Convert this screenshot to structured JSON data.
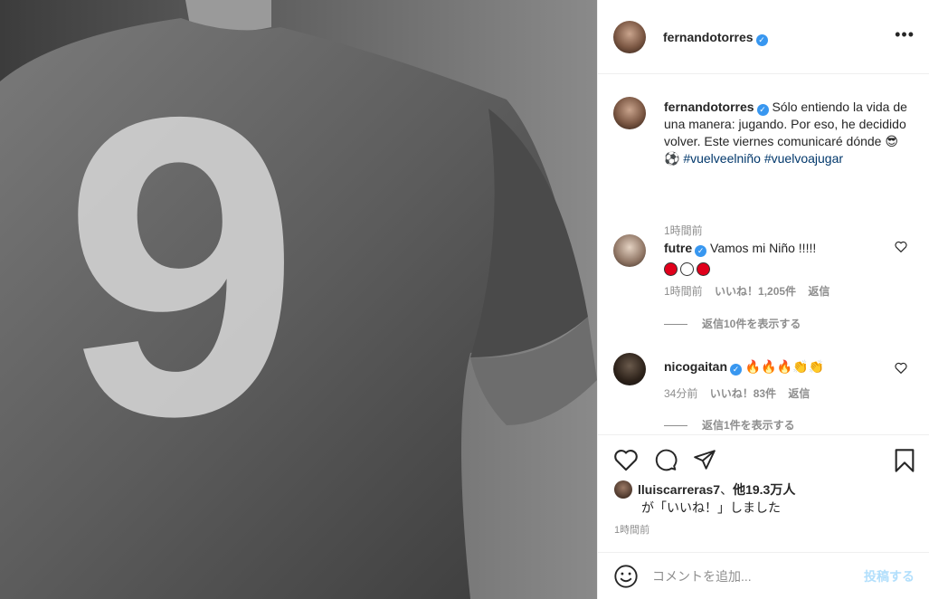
{
  "header": {
    "username": "fernandotorres",
    "verified_glyph": "✓",
    "more_label": "•••"
  },
  "media": {
    "jersey_number": "9"
  },
  "caption": {
    "username": "fernandotorres",
    "text": "Sólo entiendo la vida de una manera: jugando. Por eso, he decidido volver. Este viernes comunicaré dónde 😎 ⚽",
    "hashtag1": "#vuelveelniño",
    "hashtag2": "#vuelvoajugar",
    "time": "1時間前"
  },
  "comments": [
    {
      "username": "futre",
      "text": "Vamos mi Niño !!!!!",
      "time": "1時間前",
      "likes": "いいね！1,205件",
      "reply": "返信",
      "view_replies": "返信10件を表示する",
      "emoji_dots": [
        "#e0001b",
        "#ffffff",
        "#e0001b"
      ]
    },
    {
      "username": "nicogaitan",
      "text": "🔥🔥🔥👏👏",
      "time": "34分前",
      "likes": "いいね！83件",
      "reply": "返信",
      "view_replies": "返信1件を表示する"
    }
  ],
  "actions": {
    "icons": [
      "heart-icon",
      "comment-icon",
      "share-icon",
      "bookmark-icon"
    ],
    "liked_by_user": "lluiscarreras7",
    "liked_by_sep": "、",
    "liked_by_others": "他19.3万人",
    "liked_by_suffix": "が「いいね！」しました",
    "post_time": "1時間前"
  },
  "add_comment": {
    "placeholder": "コメントを追加...",
    "post_label": "投稿する"
  },
  "colors": {
    "verified": "#3897f0",
    "hashtag": "#00376b",
    "muted": "#8e8e8e",
    "post_button_disabled": "#b2dffc"
  }
}
